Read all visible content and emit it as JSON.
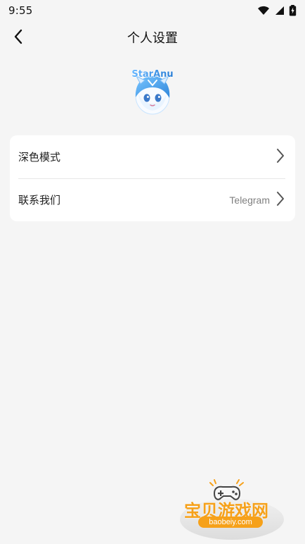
{
  "status_bar": {
    "time": "9:55",
    "icons": [
      "wifi-icon",
      "signal-icon",
      "battery-charging-icon"
    ]
  },
  "header": {
    "title": "个人设置",
    "back_icon": "chevron-left-icon"
  },
  "profile": {
    "avatar_label": "StarAnu"
  },
  "settings": {
    "items": [
      {
        "label": "深色模式",
        "value": "",
        "icon": "chevron-right-icon"
      },
      {
        "label": "联系我们",
        "value": "Telegram",
        "icon": "chevron-right-icon"
      }
    ]
  },
  "watermark": {
    "text": "宝贝游戏网",
    "domain": "baobeiy.com"
  },
  "colors": {
    "background": "#f5f5f5",
    "card": "#ffffff",
    "text_primary": "#222222",
    "text_secondary": "#7f7f7f",
    "divider": "#e8e8e8",
    "watermark_orange": "#f6a11a",
    "avatar_blue": "#67b7ff"
  }
}
